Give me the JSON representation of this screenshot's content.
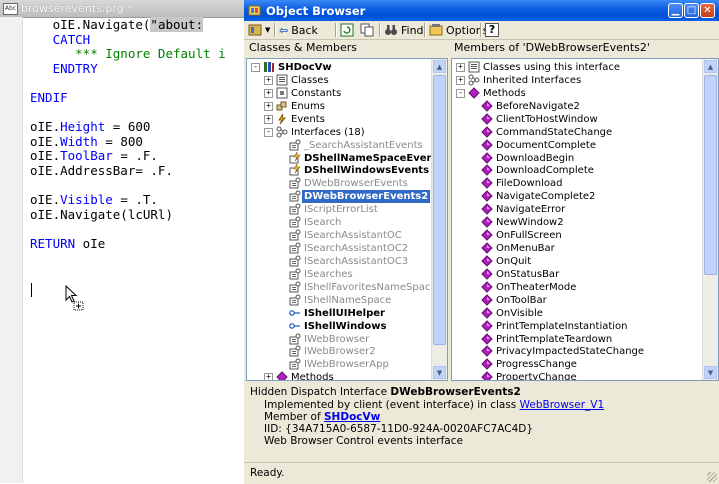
{
  "editor": {
    "title": "browserevents.prg *",
    "file_badge": "Abc",
    "code_lines": [
      "   oIE.Navigate(\"about:",
      "   CATCH",
      "      *** Ignore Default i",
      "   ENDTRY",
      "",
      "ENDIF",
      "",
      "oIE.Height = 600",
      "oIE.Width = 800",
      "oIE.ToolBar = .F.",
      "oIE.AddressBar= .F.",
      "",
      "oIE.Visible = .T.",
      "oIE.Navigate(lcURl)",
      "",
      "RETURN oIe"
    ]
  },
  "object_browser": {
    "title": "Object Browser",
    "toolbar": {
      "back_label": "Back",
      "find_label": "Find",
      "options_label": "Options",
      "help_label": "?"
    },
    "left_header": "Classes & Members",
    "right_header": "Members of 'DWebBrowserEvents2'",
    "tree": [
      {
        "label": "SHDocVw",
        "depth": 0,
        "expander": "-",
        "icon": "library-icon",
        "style": "bold"
      },
      {
        "label": "Classes",
        "depth": 1,
        "expander": "+",
        "icon": "classes-icon",
        "style": "normal"
      },
      {
        "label": "Constants",
        "depth": 1,
        "expander": "+",
        "icon": "constants-icon",
        "style": "normal"
      },
      {
        "label": "Enums",
        "depth": 1,
        "expander": "+",
        "icon": "enums-icon",
        "style": "normal"
      },
      {
        "label": "Events",
        "depth": 1,
        "expander": "+",
        "icon": "events-icon",
        "style": "normal"
      },
      {
        "label": "Interfaces (18)",
        "depth": 1,
        "expander": "-",
        "icon": "interfaces-icon",
        "style": "normal"
      },
      {
        "label": "_SearchAssistantEvents",
        "depth": 2,
        "expander": "",
        "icon": "interface-icon",
        "style": "gray"
      },
      {
        "label": "DShellNameSpaceEvents",
        "depth": 2,
        "expander": "",
        "icon": "event-interface-icon",
        "style": "bold"
      },
      {
        "label": "DShellWindowsEvents",
        "depth": 2,
        "expander": "",
        "icon": "event-interface-icon",
        "style": "bold"
      },
      {
        "label": "DWebBrowserEvents",
        "depth": 2,
        "expander": "",
        "icon": "interface-icon",
        "style": "gray"
      },
      {
        "label": "DWebBrowserEvents2",
        "depth": 2,
        "expander": "",
        "icon": "interface-icon",
        "style": "selected"
      },
      {
        "label": "IScriptErrorList",
        "depth": 2,
        "expander": "",
        "icon": "interface-icon",
        "style": "gray"
      },
      {
        "label": "ISearch",
        "depth": 2,
        "expander": "",
        "icon": "interface-icon",
        "style": "gray"
      },
      {
        "label": "ISearchAssistantOC",
        "depth": 2,
        "expander": "",
        "icon": "interface-icon",
        "style": "gray"
      },
      {
        "label": "ISearchAssistantOC2",
        "depth": 2,
        "expander": "",
        "icon": "interface-icon",
        "style": "gray"
      },
      {
        "label": "ISearchAssistantOC3",
        "depth": 2,
        "expander": "",
        "icon": "interface-icon",
        "style": "gray"
      },
      {
        "label": "ISearches",
        "depth": 2,
        "expander": "",
        "icon": "interface-icon",
        "style": "gray"
      },
      {
        "label": "IShellFavoritesNameSpace",
        "depth": 2,
        "expander": "",
        "icon": "interface-icon",
        "style": "gray"
      },
      {
        "label": "IShellNameSpace",
        "depth": 2,
        "expander": "",
        "icon": "interface-icon",
        "style": "gray"
      },
      {
        "label": "IShellUIHelper",
        "depth": 2,
        "expander": "",
        "icon": "link-interface-icon",
        "style": "bold"
      },
      {
        "label": "IShellWindows",
        "depth": 2,
        "expander": "",
        "icon": "link-interface-icon",
        "style": "bold"
      },
      {
        "label": "IWebBrowser",
        "depth": 2,
        "expander": "",
        "icon": "interface-icon",
        "style": "gray"
      },
      {
        "label": "IWebBrowser2",
        "depth": 2,
        "expander": "",
        "icon": "interface-icon",
        "style": "gray"
      },
      {
        "label": "IWebBrowserApp",
        "depth": 2,
        "expander": "",
        "icon": "interface-icon",
        "style": "gray"
      },
      {
        "label": "Methods",
        "depth": 1,
        "expander": "+",
        "icon": "methods-icon",
        "style": "normal"
      }
    ],
    "members": [
      {
        "label": "Classes using this interface",
        "depth": 0,
        "expander": "+",
        "icon": "classes-icon"
      },
      {
        "label": "Inherited Interfaces",
        "depth": 0,
        "expander": "+",
        "icon": "interfaces-icon"
      },
      {
        "label": "Methods",
        "depth": 0,
        "expander": "-",
        "icon": "methods-icon"
      },
      {
        "label": "BeforeNavigate2",
        "depth": 1,
        "expander": "",
        "icon": "method-icon"
      },
      {
        "label": "ClientToHostWindow",
        "depth": 1,
        "expander": "",
        "icon": "method-icon"
      },
      {
        "label": "CommandStateChange",
        "depth": 1,
        "expander": "",
        "icon": "method-icon"
      },
      {
        "label": "DocumentComplete",
        "depth": 1,
        "expander": "",
        "icon": "method-icon"
      },
      {
        "label": "DownloadBegin",
        "depth": 1,
        "expander": "",
        "icon": "method-icon"
      },
      {
        "label": "DownloadComplete",
        "depth": 1,
        "expander": "",
        "icon": "method-icon"
      },
      {
        "label": "FileDownload",
        "depth": 1,
        "expander": "",
        "icon": "method-icon"
      },
      {
        "label": "NavigateComplete2",
        "depth": 1,
        "expander": "",
        "icon": "method-icon"
      },
      {
        "label": "NavigateError",
        "depth": 1,
        "expander": "",
        "icon": "method-icon"
      },
      {
        "label": "NewWindow2",
        "depth": 1,
        "expander": "",
        "icon": "method-icon"
      },
      {
        "label": "OnFullScreen",
        "depth": 1,
        "expander": "",
        "icon": "method-icon"
      },
      {
        "label": "OnMenuBar",
        "depth": 1,
        "expander": "",
        "icon": "method-icon"
      },
      {
        "label": "OnQuit",
        "depth": 1,
        "expander": "",
        "icon": "method-icon"
      },
      {
        "label": "OnStatusBar",
        "depth": 1,
        "expander": "",
        "icon": "method-icon"
      },
      {
        "label": "OnTheaterMode",
        "depth": 1,
        "expander": "",
        "icon": "method-icon"
      },
      {
        "label": "OnToolBar",
        "depth": 1,
        "expander": "",
        "icon": "method-icon"
      },
      {
        "label": "OnVisible",
        "depth": 1,
        "expander": "",
        "icon": "method-icon"
      },
      {
        "label": "PrintTemplateInstantiation",
        "depth": 1,
        "expander": "",
        "icon": "method-icon"
      },
      {
        "label": "PrintTemplateTeardown",
        "depth": 1,
        "expander": "",
        "icon": "method-icon"
      },
      {
        "label": "PrivacyImpactedStateChange",
        "depth": 1,
        "expander": "",
        "icon": "method-icon"
      },
      {
        "label": "ProgressChange",
        "depth": 1,
        "expander": "",
        "icon": "method-icon"
      },
      {
        "label": "PropertyChange",
        "depth": 1,
        "expander": "",
        "icon": "method-icon"
      }
    ],
    "description": {
      "heading_prefix": "Hidden Dispatch Interface ",
      "heading_name": "DWebBrowserEvents2",
      "implemented_prefix": "Implemented by client (event interface) in class ",
      "implemented_link": "WebBrowser_V1",
      "member_prefix": "Member of ",
      "member_link": "SHDocVw",
      "iid": "IID: {34A715A0-6587-11D0-924A-0020AFC7AC4D}",
      "summary": "Web Browser Control events interface"
    },
    "status": "Ready."
  },
  "colors": {
    "selection": "#316ac5",
    "method_icon": "#b020c0",
    "keyword": "#0000ff",
    "comment": "#008000",
    "titlebar": "#0a5ce0"
  }
}
